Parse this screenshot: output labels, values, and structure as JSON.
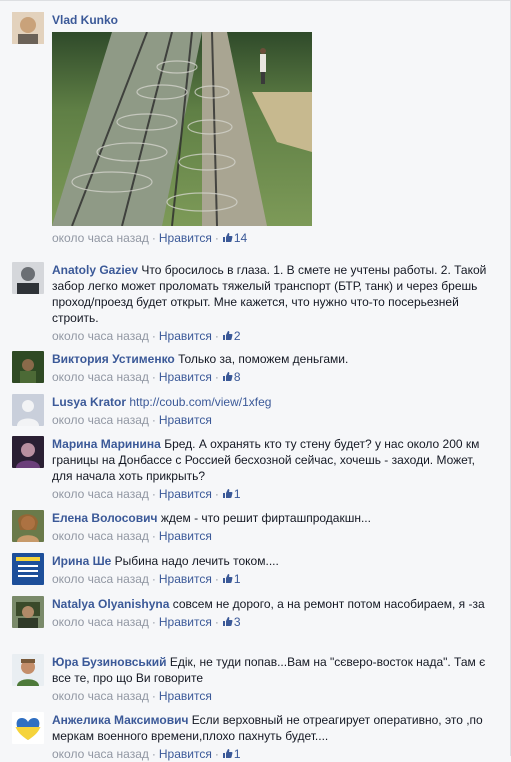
{
  "comments": [
    {
      "author": "Vlad Kunko",
      "text": "",
      "time": "около часа назад",
      "like": "Нравится",
      "likes": "14",
      "has_photo": true,
      "avatar_color": "#c9a27a"
    },
    {
      "author": "Anatoly Gaziev",
      "text": "Что бросилось в глаза. 1. В смете не учтены работы. 2. Такой забор легко может проломать тяжелый транспорт (БТР, танк) и через брешь проход/проезд будет открыт. Мне кажется, что нужно что-то посерьезней строить.",
      "time": "около часа назад",
      "like": "Нравится",
      "likes": "2",
      "avatar_color": "#8a8f96"
    },
    {
      "author": "Виктория Устименко",
      "text": "Только за, поможем деньгами.",
      "time": "около часа назад",
      "like": "Нравится",
      "likes": "8",
      "avatar_color": "#3f5a2e"
    },
    {
      "author": "Lusya Krator",
      "text": "",
      "link": "http://coub.com/view/1xfeg",
      "time": "около часа назад",
      "like": "Нравится",
      "likes": "",
      "avatar_color": "#c9cdd6"
    },
    {
      "author": "Марина Маринина",
      "text": "Бред. А охранять кто ту стену будет? у нас около 200 км границы на Донбассе с Россией бесхозной сейчас, хочешь - заходи. Может, для начала хоть прикрыть?",
      "time": "около часа назад",
      "like": "Нравится",
      "likes": "1",
      "avatar_color": "#5a3d6b"
    },
    {
      "author": "Елена Волосович",
      "text": "ждем - что решит фирташпродакшн...",
      "time": "около часа назад",
      "like": "Нравится",
      "likes": "",
      "avatar_color": "#b98a5a"
    },
    {
      "author": "Ирина Ше",
      "text": "Рыбина надо лечить током....",
      "time": "около часа назад",
      "like": "Нравится",
      "likes": "1",
      "avatar_color": "#2d5fa8"
    },
    {
      "author": "Natalya Olyanishyna",
      "text": "совсем не дорого, а на ремонт потом насобираем, я -за",
      "time": "около часа назад",
      "like": "Нравится",
      "likes": "3",
      "avatar_color": "#4a5a3a"
    },
    {
      "author": "Юра Бузиновський",
      "text": "Едік, не туди попав...Вам на \"сєверо-восток нада\". Там є все те, про що Ви говорите",
      "time": "около часа назад",
      "like": "Нравится",
      "likes": "",
      "avatar_color": "#6a8a5a"
    },
    {
      "author": "Анжелика Максимович",
      "text": "Если верховный не отреагирует оперативно, это ,по меркам военного времени,плохо пахнуть будет....",
      "time": "около часа назад",
      "like": "Нравится",
      "likes": "1",
      "avatar_color": "#f2c230"
    }
  ]
}
